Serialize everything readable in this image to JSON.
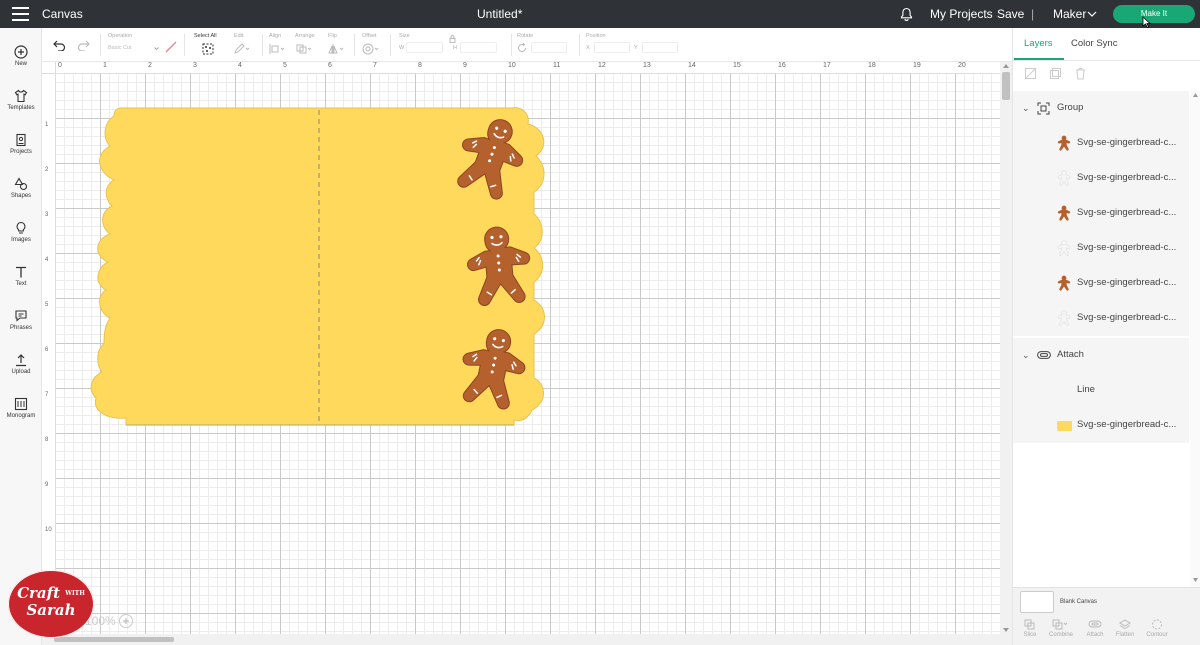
{
  "topbar": {
    "title": "Canvas",
    "document_title": "Untitled*",
    "my_projects": "My Projects",
    "save": "Save",
    "divider": "|",
    "machine": "Maker",
    "make_it": "Make It"
  },
  "sidebar": {
    "items": [
      {
        "label": "New",
        "icon": "plus-circle-icon"
      },
      {
        "label": "Templates",
        "icon": "shirt-icon"
      },
      {
        "label": "Projects",
        "icon": "projects-icon"
      },
      {
        "label": "Shapes",
        "icon": "shapes-icon"
      },
      {
        "label": "Images",
        "icon": "lightbulb-icon"
      },
      {
        "label": "Text",
        "icon": "text-icon"
      },
      {
        "label": "Phrases",
        "icon": "speech-bubble-icon"
      },
      {
        "label": "Upload",
        "icon": "upload-icon"
      },
      {
        "label": "Monogram",
        "icon": "monogram-icon"
      }
    ]
  },
  "toolbar": {
    "operation_label": "Operation",
    "operation_value": "Basic Cut",
    "select_all": "Select All",
    "edit": "Edit",
    "align": "Align",
    "arrange": "Arrange",
    "flip": "Flip",
    "offset": "Offset",
    "size": "Size",
    "w": "W",
    "h": "H",
    "rotate": "Rotate",
    "position": "Position",
    "x": "X",
    "y": "Y"
  },
  "ruler": {
    "top_ticks": [
      "0",
      "1",
      "2",
      "3",
      "4",
      "5",
      "6",
      "7",
      "8",
      "9",
      "10",
      "11",
      "12",
      "13",
      "14",
      "15",
      "16",
      "17",
      "18",
      "19",
      "20"
    ],
    "left_ticks": [
      "1",
      "2",
      "3",
      "4",
      "5",
      "6",
      "7",
      "8",
      "9",
      "10"
    ]
  },
  "zoom": {
    "value": "100%",
    "plus": "+"
  },
  "watermark": {
    "line1": "Craft",
    "line2": "WITH",
    "line3": "Sarah"
  },
  "panel": {
    "tabs": {
      "layers": "Layers",
      "color_sync": "Color Sync"
    },
    "group_label": "Group",
    "group_layers": [
      "Svg-se-gingerbread-c...",
      "Svg-se-gingerbread-c...",
      "Svg-se-gingerbread-c...",
      "Svg-se-gingerbread-c...",
      "Svg-se-gingerbread-c...",
      "Svg-se-gingerbread-c..."
    ],
    "attach_label": "Attach",
    "attach_layers": [
      "Line",
      "Svg-se-gingerbread-c..."
    ],
    "blank_canvas": "Blank Canvas",
    "bottom_tools": [
      "Slice",
      "Combine",
      "Attach",
      "Flatten",
      "Contour"
    ]
  },
  "colors": {
    "topbar": "#2f3237",
    "accent": "#1aa776",
    "card": "#ffd95c",
    "card_outline": "#f2c94c",
    "gingerbread": "#b5612e"
  }
}
